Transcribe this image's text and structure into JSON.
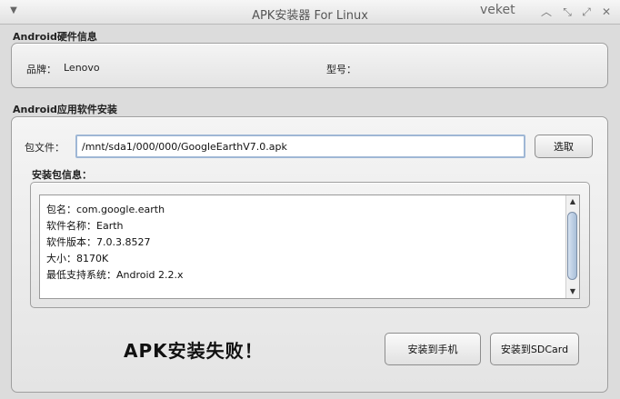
{
  "window": {
    "title": "APK安装器 For Linux",
    "user": "veket",
    "menu_icon": "triangle-down-icon",
    "controls": [
      "minimize-icon",
      "restore-icon",
      "close-icon"
    ]
  },
  "hardware": {
    "section_title": "Android硬件信息",
    "brand_label": "品牌：",
    "brand_value": "Lenovo",
    "model_label": "型号："
  },
  "install": {
    "section_title": "Android应用软件安装",
    "file_label": "包文件：",
    "file_path": "/mnt/sda1/000/000/GoogleEarthV7.0.apk",
    "choose_button": "选取",
    "info_title": "安装包信息：",
    "info_lines": [
      "包名：com.google.earth",
      "软件名称：Earth",
      "软件版本：7.0.3.8527",
      "大小：8170K",
      "最低支持系统：Android 2.2.x"
    ]
  },
  "status": {
    "message": "APK安装失败！"
  },
  "buttons": {
    "install_phone": "安装到手机",
    "install_sdcard": "安装到SDCard"
  }
}
